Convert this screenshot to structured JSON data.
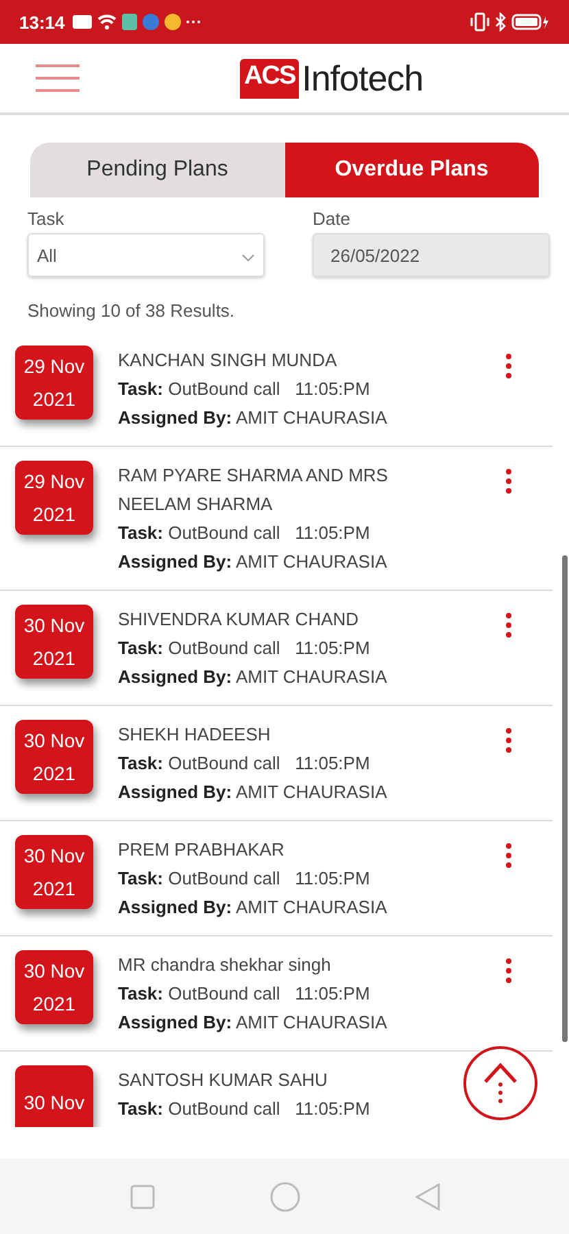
{
  "status_bar": {
    "time": "13:14"
  },
  "header": {
    "logo_badge": "ACS",
    "logo_name": "Infotech"
  },
  "tabs": [
    {
      "label": "Pending Plans",
      "selected": false
    },
    {
      "label": "Overdue Plans",
      "selected": true
    }
  ],
  "filters": [
    {
      "label": "Task",
      "value": "All",
      "kind": "select"
    },
    {
      "label": "Date",
      "value": "26/05/2022",
      "kind": "date"
    }
  ],
  "results": "Showing 10 of 38 Results.",
  "plans": [
    {
      "day": "29 Nov",
      "year": "2021",
      "name": "KANCHAN SINGH MUNDA",
      "task_label": "Task:",
      "task": "OutBound call",
      "time": "11:05:PM",
      "assigned_label": "Assigned By:",
      "assigned": "AMIT CHAURASIA"
    },
    {
      "day": "29 Nov",
      "year": "2021",
      "name": "RAM PYARE SHARMA AND MRS NEELAM SHARMA",
      "task_label": "Task:",
      "task": "OutBound call",
      "time": "11:05:PM",
      "assigned_label": "Assigned By:",
      "assigned": "AMIT CHAURASIA"
    },
    {
      "day": "30 Nov",
      "year": "2021",
      "name": "SHIVENDRA KUMAR CHAND",
      "task_label": "Task:",
      "task": "OutBound call",
      "time": "11:05:PM",
      "assigned_label": "Assigned By:",
      "assigned": "AMIT CHAURASIA"
    },
    {
      "day": "30 Nov",
      "year": "2021",
      "name": "SHEKH HADEESH",
      "task_label": "Task:",
      "task": "OutBound call",
      "time": "11:05:PM",
      "assigned_label": "Assigned By:",
      "assigned": "AMIT CHAURASIA"
    },
    {
      "day": "30 Nov",
      "year": "2021",
      "name": "PREM PRABHAKAR",
      "task_label": "Task:",
      "task": "OutBound call",
      "time": "11:05:PM",
      "assigned_label": "Assigned By:",
      "assigned": "AMIT CHAURASIA"
    },
    {
      "day": "30 Nov",
      "year": "2021",
      "name": "MR chandra shekhar singh",
      "task_label": "Task:",
      "task": "OutBound call",
      "time": "11:05:PM",
      "assigned_label": "Assigned By:",
      "assigned": "AMIT CHAURASIA"
    },
    {
      "day": "30 Nov",
      "name": "SANTOSH KUMAR SAHU",
      "task_label": "Task:",
      "task": "OutBound call",
      "time": "11:05:PM"
    }
  ]
}
